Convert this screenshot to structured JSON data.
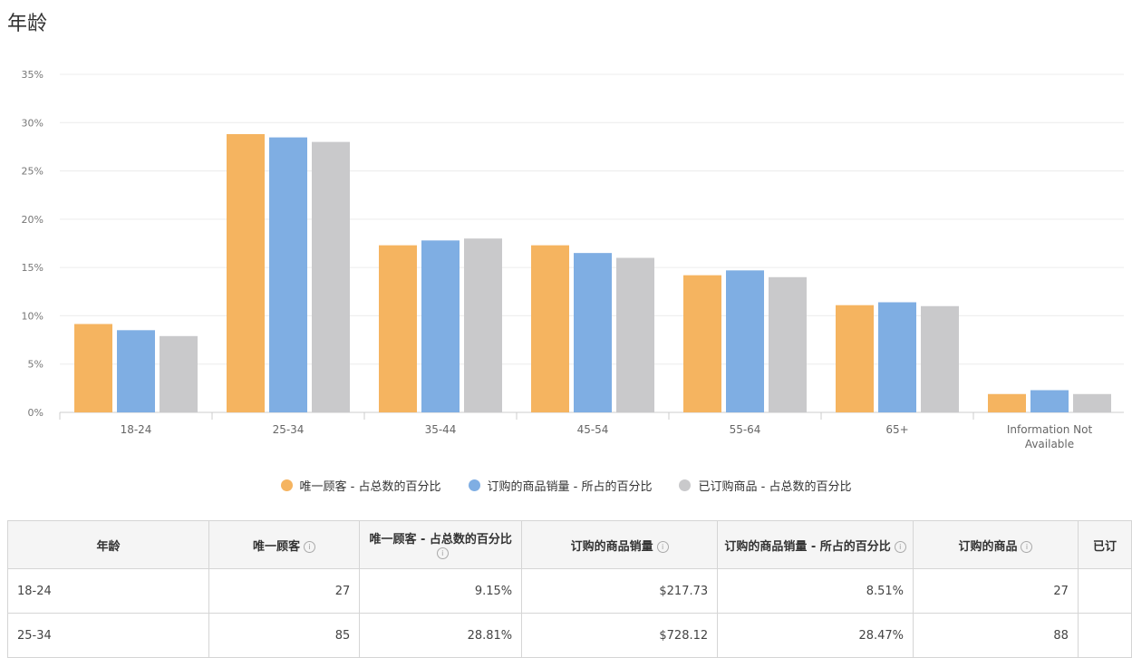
{
  "page_title": "年龄",
  "colors": {
    "series1": "#F5B460",
    "series2": "#7FAEE3",
    "series3": "#C9C9CB",
    "grid": "#ececec"
  },
  "chart_data": {
    "type": "bar",
    "categories": [
      "18-24",
      "25-34",
      "35-44",
      "45-54",
      "55-64",
      "65+",
      "Information Not Available"
    ],
    "category_lines": [
      [
        "18-24"
      ],
      [
        "25-34"
      ],
      [
        "35-44"
      ],
      [
        "45-54"
      ],
      [
        "55-64"
      ],
      [
        "65+"
      ],
      [
        "Information Not",
        "Available"
      ]
    ],
    "series": [
      {
        "name": "唯一顾客 - 占总数的百分比",
        "values": [
          9.15,
          28.81,
          17.3,
          17.3,
          14.2,
          11.1,
          1.9
        ]
      },
      {
        "name": "订购的商品销量 - 所占的百分比",
        "values": [
          8.51,
          28.47,
          17.8,
          16.5,
          14.7,
          11.4,
          2.3
        ]
      },
      {
        "name": "已订购商品 - 占总数的百分比",
        "values": [
          7.9,
          28.0,
          18.0,
          16.0,
          14.0,
          11.0,
          1.9
        ]
      }
    ],
    "yticks": [
      "0%",
      "5%",
      "10%",
      "15%",
      "20%",
      "25%",
      "30%",
      "35%"
    ],
    "ylim": [
      0,
      35
    ],
    "grid": true,
    "legend_position": "bottom"
  },
  "table": {
    "headers": [
      {
        "label": "年龄",
        "info": false
      },
      {
        "label": "唯一顾客",
        "info": true
      },
      {
        "label": "唯一顾客 - 占总数的百分比",
        "info": true
      },
      {
        "label": "订购的商品销量",
        "info": true
      },
      {
        "label": "订购的商品销量 - 所占的百分比",
        "info": true
      },
      {
        "label": "订购的商品",
        "info": true
      },
      {
        "label": "已订",
        "info": false
      }
    ],
    "rows": [
      [
        "18-24",
        "27",
        "9.15%",
        "$217.73",
        "8.51%",
        "27",
        ""
      ],
      [
        "25-34",
        "85",
        "28.81%",
        "$728.12",
        "28.47%",
        "88",
        ""
      ]
    ]
  }
}
